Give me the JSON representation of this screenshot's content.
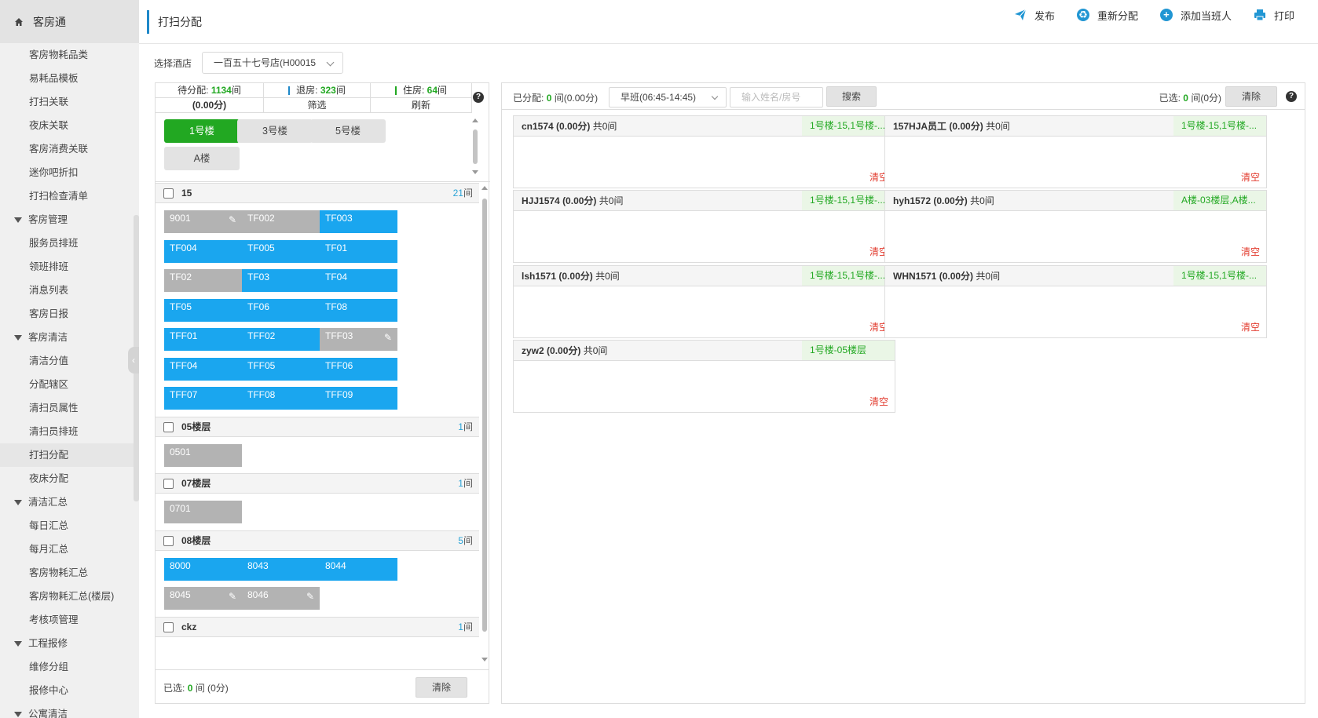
{
  "sidebar": {
    "brand": "客房通",
    "items": [
      {
        "label": "客房物耗品类",
        "type": "item"
      },
      {
        "label": "易耗品模板",
        "type": "item"
      },
      {
        "label": "打扫关联",
        "type": "item"
      },
      {
        "label": "夜床关联",
        "type": "item"
      },
      {
        "label": "客房消费关联",
        "type": "item"
      },
      {
        "label": "迷你吧折扣",
        "type": "item"
      },
      {
        "label": "打扫检查清单",
        "type": "item"
      },
      {
        "label": "客房管理",
        "type": "group"
      },
      {
        "label": "服务员排班",
        "type": "item"
      },
      {
        "label": "领班排班",
        "type": "item"
      },
      {
        "label": "消息列表",
        "type": "item"
      },
      {
        "label": "客房日报",
        "type": "item"
      },
      {
        "label": "客房清洁",
        "type": "group"
      },
      {
        "label": "清洁分值",
        "type": "item"
      },
      {
        "label": "分配辖区",
        "type": "item"
      },
      {
        "label": "清扫员属性",
        "type": "item"
      },
      {
        "label": "清扫员排班",
        "type": "item"
      },
      {
        "label": "打扫分配",
        "type": "item",
        "active": true
      },
      {
        "label": "夜床分配",
        "type": "item"
      },
      {
        "label": "清洁汇总",
        "type": "group"
      },
      {
        "label": "每日汇总",
        "type": "item"
      },
      {
        "label": "每月汇总",
        "type": "item"
      },
      {
        "label": "客房物耗汇总",
        "type": "item"
      },
      {
        "label": "客房物耗汇总(楼层)",
        "type": "item"
      },
      {
        "label": "考核项管理",
        "type": "item"
      },
      {
        "label": "工程报修",
        "type": "group"
      },
      {
        "label": "维修分组",
        "type": "item"
      },
      {
        "label": "报修中心",
        "type": "item"
      },
      {
        "label": "公寓清洁",
        "type": "group"
      }
    ]
  },
  "header": {
    "title": "打扫分配",
    "actions": {
      "publish": "发布",
      "reassign": "重新分配",
      "add_staff": "添加当班人",
      "print": "打印"
    }
  },
  "hotel": {
    "label": "选择酒店",
    "value": "一百五十七号店(H00015"
  },
  "stats": {
    "pending_label": "待分配:",
    "pending_value": "1134",
    "pending_unit": "间",
    "checkout_label": "退房:",
    "checkout_value": "323",
    "checkout_unit": "间",
    "occupied_label": "住房:",
    "occupied_value": "64",
    "occupied_unit": "间",
    "score": "(0.00分)",
    "filter": "筛选",
    "refresh": "刷新"
  },
  "floor_tabs": [
    "1号楼",
    "3号楼",
    "5号楼",
    "A楼"
  ],
  "floors": [
    {
      "name": "15",
      "count": "21",
      "unit": "间",
      "rooms": [
        {
          "no": "9001",
          "status": "gray",
          "tool": true
        },
        {
          "no": "TF002",
          "status": "gray"
        },
        {
          "no": "TF003",
          "status": "blue"
        },
        {
          "no": "TF004",
          "status": "blue"
        },
        {
          "no": "TF005",
          "status": "blue"
        },
        {
          "no": "TF01",
          "status": "blue"
        },
        {
          "no": "TF02",
          "status": "gray"
        },
        {
          "no": "TF03",
          "status": "blue"
        },
        {
          "no": "TF04",
          "status": "blue"
        },
        {
          "no": "TF05",
          "status": "blue"
        },
        {
          "no": "TF06",
          "status": "blue"
        },
        {
          "no": "TF08",
          "status": "blue"
        },
        {
          "no": "TFF01",
          "status": "blue"
        },
        {
          "no": "TFF02",
          "status": "blue"
        },
        {
          "no": "TFF03",
          "status": "gray",
          "tool": true
        },
        {
          "no": "TFF04",
          "status": "blue"
        },
        {
          "no": "TFF05",
          "status": "blue"
        },
        {
          "no": "TFF06",
          "status": "blue"
        },
        {
          "no": "TFF07",
          "status": "blue"
        },
        {
          "no": "TFF08",
          "status": "blue"
        },
        {
          "no": "TFF09",
          "status": "blue"
        }
      ]
    },
    {
      "name": "05楼层",
      "count": "1",
      "unit": "间",
      "rooms": [
        {
          "no": "0501",
          "status": "gray"
        }
      ]
    },
    {
      "name": "07楼层",
      "count": "1",
      "unit": "间",
      "rooms": [
        {
          "no": "0701",
          "status": "gray"
        }
      ]
    },
    {
      "name": "08楼层",
      "count": "5",
      "unit": "间",
      "rooms": [
        {
          "no": "8000",
          "status": "blue"
        },
        {
          "no": "8043",
          "status": "blue"
        },
        {
          "no": "8044",
          "status": "blue"
        },
        {
          "no": "8045",
          "status": "gray",
          "tool": true
        },
        {
          "no": "8046",
          "status": "gray",
          "tool": true
        }
      ]
    },
    {
      "name": "ckz",
      "count": "1",
      "unit": "间",
      "rooms": []
    }
  ],
  "left_footer": {
    "prefix": "已选:",
    "count": "0",
    "mid": "间 (",
    "score": "0分",
    "suffix": ")",
    "clear": "清除"
  },
  "right_toolbar": {
    "assigned_prefix": "已分配:",
    "assigned_count": "0",
    "assigned_suffix": "间(0.00分)",
    "shift": "早班(06:45-14:45)",
    "search_placeholder": "输入姓名/房号",
    "search_button": "搜索",
    "selected_prefix": "已选:",
    "selected_count": "0",
    "selected_suffix": "间(0分)",
    "clear": "清除"
  },
  "staff": [
    {
      "name": "cn1574",
      "score": "(0.00分)",
      "total": "共0间",
      "area": "1号楼-15,1号楼-...",
      "clear": "清空"
    },
    {
      "name": "157HJA员工",
      "score": "(0.00分)",
      "total": "共0间",
      "area": "1号楼-15,1号楼-...",
      "clear": "清空"
    },
    {
      "name": "HJJ1574",
      "score": "(0.00分)",
      "total": "共0间",
      "area": "1号楼-15,1号楼-...",
      "clear": "清空"
    },
    {
      "name": "hyh1572",
      "score": "(0.00分)",
      "total": "共0间",
      "area": "A楼-03楼层,A楼...",
      "clear": "清空"
    },
    {
      "name": "lsh1571",
      "score": "(0.00分)",
      "total": "共0间",
      "area": "1号楼-15,1号楼-...",
      "clear": "清空"
    },
    {
      "name": "WHN1571",
      "score": "(0.00分)",
      "total": "共0间",
      "area": "1号楼-15,1号楼-...",
      "clear": "清空"
    },
    {
      "name": "zyw2",
      "score": "(0.00分)",
      "total": "共0间",
      "area": "1号楼-05楼层",
      "clear": "清空"
    }
  ],
  "colors": {
    "accent": "#1e88c9",
    "green": "#22a822",
    "room_blue": "#1aa6ef",
    "room_gray": "#b3b3b3",
    "danger": "#e23b2e"
  },
  "icons": {
    "home": "home-icon",
    "publish": "paper-plane-icon",
    "reassign": "recycle-icon",
    "add_staff": "plus-circle-icon",
    "print": "printer-icon",
    "help": "help-icon",
    "tool": "wrench-icon"
  }
}
